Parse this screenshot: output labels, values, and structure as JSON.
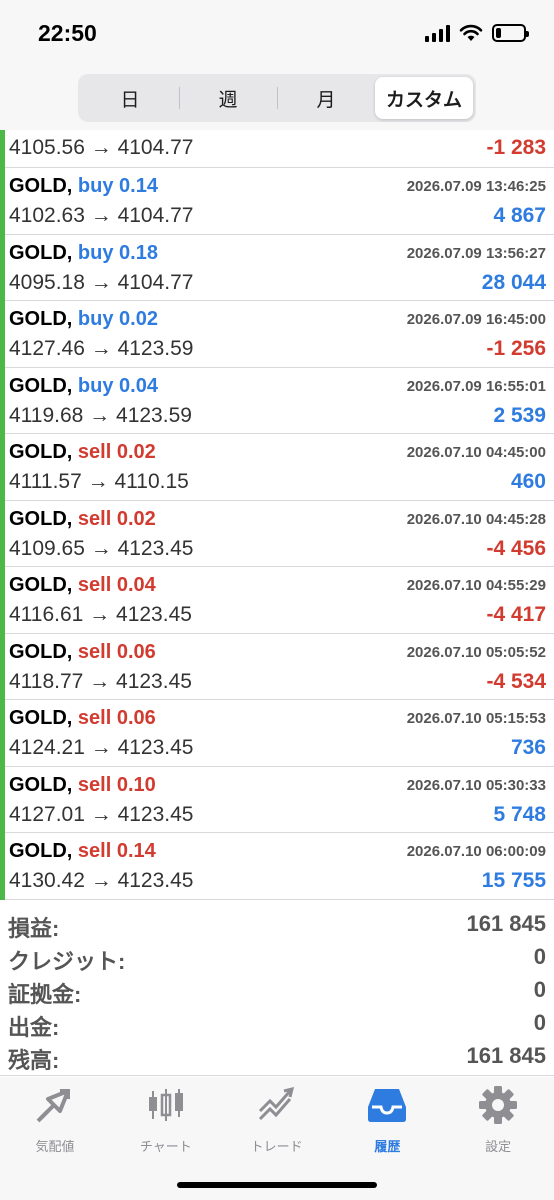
{
  "status": {
    "time": "22:50",
    "battery_level": 0.2
  },
  "segments": [
    {
      "label": "日",
      "active": false
    },
    {
      "label": "週",
      "active": false
    },
    {
      "label": "月",
      "active": false
    },
    {
      "label": "カスタム",
      "active": true
    }
  ],
  "deals": [
    {
      "symbol": "",
      "side": "",
      "lot": "",
      "time": "",
      "prices": "4105.56 → 4104.77",
      "profit": "-1 283",
      "profit_sign": "neg",
      "partial": true
    },
    {
      "symbol": "GOLD,",
      "side": "buy",
      "lot": "buy 0.14",
      "time": "2026.07.09 13:46:25",
      "prices": "4102.63 → 4104.77",
      "profit": "4 867",
      "profit_sign": "pos"
    },
    {
      "symbol": "GOLD,",
      "side": "buy",
      "lot": "buy 0.18",
      "time": "2026.07.09 13:56:27",
      "prices": "4095.18 → 4104.77",
      "profit": "28 044",
      "profit_sign": "pos"
    },
    {
      "symbol": "GOLD,",
      "side": "buy",
      "lot": "buy 0.02",
      "time": "2026.07.09 16:45:00",
      "prices": "4127.46 → 4123.59",
      "profit": "-1 256",
      "profit_sign": "neg"
    },
    {
      "symbol": "GOLD,",
      "side": "buy",
      "lot": "buy 0.04",
      "time": "2026.07.09 16:55:01",
      "prices": "4119.68 → 4123.59",
      "profit": "2 539",
      "profit_sign": "pos"
    },
    {
      "symbol": "GOLD,",
      "side": "sell",
      "lot": "sell 0.02",
      "time": "2026.07.10 04:45:00",
      "prices": "4111.57 → 4110.15",
      "profit": "460",
      "profit_sign": "pos"
    },
    {
      "symbol": "GOLD,",
      "side": "sell",
      "lot": "sell 0.02",
      "time": "2026.07.10 04:45:28",
      "prices": "4109.65 → 4123.45",
      "profit": "-4 456",
      "profit_sign": "neg"
    },
    {
      "symbol": "GOLD,",
      "side": "sell",
      "lot": "sell 0.04",
      "time": "2026.07.10 04:55:29",
      "prices": "4116.61 → 4123.45",
      "profit": "-4 417",
      "profit_sign": "neg"
    },
    {
      "symbol": "GOLD,",
      "side": "sell",
      "lot": "sell 0.06",
      "time": "2026.07.10 05:05:52",
      "prices": "4118.77 → 4123.45",
      "profit": "-4 534",
      "profit_sign": "neg"
    },
    {
      "symbol": "GOLD,",
      "side": "sell",
      "lot": "sell 0.06",
      "time": "2026.07.10 05:15:53",
      "prices": "4124.21 → 4123.45",
      "profit": "736",
      "profit_sign": "pos"
    },
    {
      "symbol": "GOLD,",
      "side": "sell",
      "lot": "sell 0.10",
      "time": "2026.07.10 05:30:33",
      "prices": "4127.01 → 4123.45",
      "profit": "5 748",
      "profit_sign": "pos"
    },
    {
      "symbol": "GOLD,",
      "side": "sell",
      "lot": "sell 0.14",
      "time": "2026.07.10 06:00:09",
      "prices": "4130.42 → 4123.45",
      "profit": "15 755",
      "profit_sign": "pos"
    }
  ],
  "summary": [
    {
      "label": "損益:",
      "value": "161 845"
    },
    {
      "label": "クレジット:",
      "value": "0"
    },
    {
      "label": "証拠金:",
      "value": "0"
    },
    {
      "label": "出金:",
      "value": "0"
    },
    {
      "label": "残高:",
      "value": "161 845"
    }
  ],
  "tabs": [
    {
      "label": "気配値",
      "icon": "quotes-icon",
      "active": false
    },
    {
      "label": "チャート",
      "icon": "chart-icon",
      "active": false
    },
    {
      "label": "トレード",
      "icon": "trade-icon",
      "active": false
    },
    {
      "label": "履歴",
      "icon": "history-icon",
      "active": true
    },
    {
      "label": "設定",
      "icon": "settings-icon",
      "active": false
    }
  ],
  "colors": {
    "buy": "#2f7ce0",
    "sell": "#d23b2f",
    "accent": "#2f7ce0",
    "bar": "#4cb848"
  }
}
